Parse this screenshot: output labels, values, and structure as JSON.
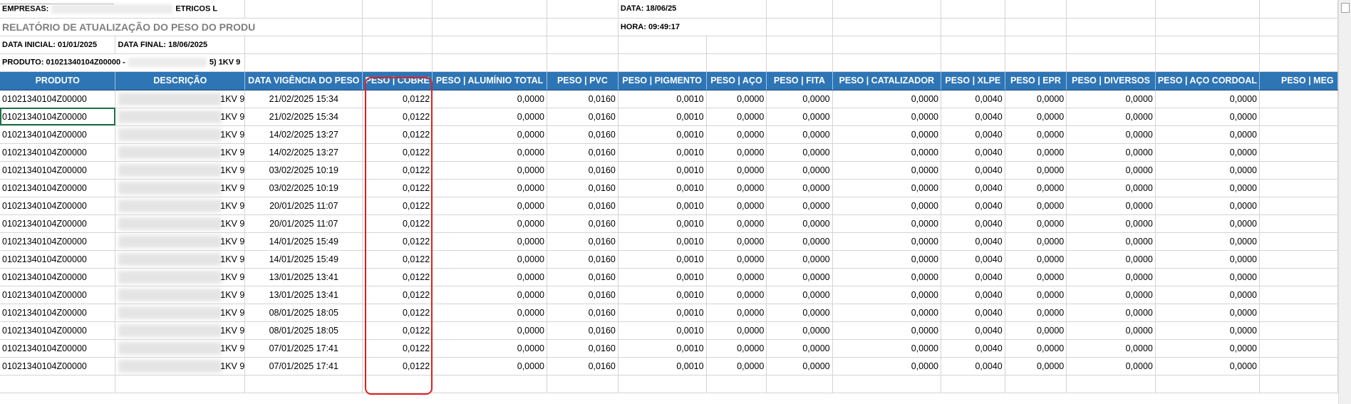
{
  "meta": {
    "empresas_label": "EMPRESAS:",
    "empresas_tail": "ETRICOS L",
    "title": "RELATÓRIO DE ATUALIZAÇÃO DO PESO DO PRODU",
    "data_inicial": "DATA INICIAL: 01/01/2025",
    "data_final": "DATA FINAL: 18/06/2025",
    "produto_prefix": "PRODUTO: 01021340104Z00000 -",
    "produto_tail": "5) 1KV 9",
    "data_label": "DATA: 18/06/25",
    "hora_label": "HORA: 09:49:17"
  },
  "columns": [
    "PRODUTO",
    "DESCRIÇÃO",
    "DATA VIGÊNCIA DO PESO",
    "PESO | COBRE",
    "PESO | ALUMÍNIO TOTAL",
    "PESO | PVC",
    "PESO | PIGMENTO",
    "PESO | AÇO",
    "PESO | FITA",
    "PESO | CATALIZADOR",
    "PESO | XLPE",
    "PESO | EPR",
    "PESO | DIVERSOS",
    "PESO | AÇO CORDOAL",
    "PESO | MEG"
  ],
  "rows": [
    {
      "produto": "01021340104Z00000",
      "desc_tail": "1KV 9",
      "data": "21/02/2025 15:34",
      "cobre": "0,0122",
      "aluminio": "0,0000",
      "pvc": "0,0160",
      "pigmento": "0,0010",
      "aco": "0,0000",
      "fita": "0,0000",
      "catalizador": "0,0000",
      "xlpe": "0,0040",
      "epr": "0,0000",
      "diversos": "0,0000",
      "aco_cordoal": "0,0000"
    },
    {
      "produto": "01021340104Z00000",
      "desc_tail": "1KV 9",
      "data": "21/02/2025 15:34",
      "cobre": "0,0122",
      "aluminio": "0,0000",
      "pvc": "0,0160",
      "pigmento": "0,0010",
      "aco": "0,0000",
      "fita": "0,0000",
      "catalizador": "0,0000",
      "xlpe": "0,0040",
      "epr": "0,0000",
      "diversos": "0,0000",
      "aco_cordoal": "0,0000"
    },
    {
      "produto": "01021340104Z00000",
      "desc_tail": "1KV 9",
      "data": "14/02/2025 13:27",
      "cobre": "0,0122",
      "aluminio": "0,0000",
      "pvc": "0,0160",
      "pigmento": "0,0010",
      "aco": "0,0000",
      "fita": "0,0000",
      "catalizador": "0,0000",
      "xlpe": "0,0040",
      "epr": "0,0000",
      "diversos": "0,0000",
      "aco_cordoal": "0,0000"
    },
    {
      "produto": "01021340104Z00000",
      "desc_tail": "1KV 9",
      "data": "14/02/2025 13:27",
      "cobre": "0,0122",
      "aluminio": "0,0000",
      "pvc": "0,0160",
      "pigmento": "0,0010",
      "aco": "0,0000",
      "fita": "0,0000",
      "catalizador": "0,0000",
      "xlpe": "0,0040",
      "epr": "0,0000",
      "diversos": "0,0000",
      "aco_cordoal": "0,0000"
    },
    {
      "produto": "01021340104Z00000",
      "desc_tail": "1KV 9",
      "data": "03/02/2025 10:19",
      "cobre": "0,0122",
      "aluminio": "0,0000",
      "pvc": "0,0160",
      "pigmento": "0,0010",
      "aco": "0,0000",
      "fita": "0,0000",
      "catalizador": "0,0000",
      "xlpe": "0,0040",
      "epr": "0,0000",
      "diversos": "0,0000",
      "aco_cordoal": "0,0000"
    },
    {
      "produto": "01021340104Z00000",
      "desc_tail": "1KV 9",
      "data": "03/02/2025 10:19",
      "cobre": "0,0122",
      "aluminio": "0,0000",
      "pvc": "0,0160",
      "pigmento": "0,0010",
      "aco": "0,0000",
      "fita": "0,0000",
      "catalizador": "0,0000",
      "xlpe": "0,0040",
      "epr": "0,0000",
      "diversos": "0,0000",
      "aco_cordoal": "0,0000"
    },
    {
      "produto": "01021340104Z00000",
      "desc_tail": "1KV 9",
      "data": "20/01/2025 11:07",
      "cobre": "0,0122",
      "aluminio": "0,0000",
      "pvc": "0,0160",
      "pigmento": "0,0010",
      "aco": "0,0000",
      "fita": "0,0000",
      "catalizador": "0,0000",
      "xlpe": "0,0040",
      "epr": "0,0000",
      "diversos": "0,0000",
      "aco_cordoal": "0,0000"
    },
    {
      "produto": "01021340104Z00000",
      "desc_tail": "1KV 9",
      "data": "20/01/2025 11:07",
      "cobre": "0,0122",
      "aluminio": "0,0000",
      "pvc": "0,0160",
      "pigmento": "0,0010",
      "aco": "0,0000",
      "fita": "0,0000",
      "catalizador": "0,0000",
      "xlpe": "0,0040",
      "epr": "0,0000",
      "diversos": "0,0000",
      "aco_cordoal": "0,0000"
    },
    {
      "produto": "01021340104Z00000",
      "desc_tail": "1KV 9",
      "data": "14/01/2025 15:49",
      "cobre": "0,0122",
      "aluminio": "0,0000",
      "pvc": "0,0160",
      "pigmento": "0,0010",
      "aco": "0,0000",
      "fita": "0,0000",
      "catalizador": "0,0000",
      "xlpe": "0,0040",
      "epr": "0,0000",
      "diversos": "0,0000",
      "aco_cordoal": "0,0000"
    },
    {
      "produto": "01021340104Z00000",
      "desc_tail": "1KV 9",
      "data": "14/01/2025 15:49",
      "cobre": "0,0122",
      "aluminio": "0,0000",
      "pvc": "0,0160",
      "pigmento": "0,0010",
      "aco": "0,0000",
      "fita": "0,0000",
      "catalizador": "0,0000",
      "xlpe": "0,0040",
      "epr": "0,0000",
      "diversos": "0,0000",
      "aco_cordoal": "0,0000"
    },
    {
      "produto": "01021340104Z00000",
      "desc_tail": "1KV 9",
      "data": "13/01/2025 13:41",
      "cobre": "0,0122",
      "aluminio": "0,0000",
      "pvc": "0,0160",
      "pigmento": "0,0010",
      "aco": "0,0000",
      "fita": "0,0000",
      "catalizador": "0,0000",
      "xlpe": "0,0040",
      "epr": "0,0000",
      "diversos": "0,0000",
      "aco_cordoal": "0,0000"
    },
    {
      "produto": "01021340104Z00000",
      "desc_tail": "1KV 9",
      "data": "13/01/2025 13:41",
      "cobre": "0,0122",
      "aluminio": "0,0000",
      "pvc": "0,0160",
      "pigmento": "0,0010",
      "aco": "0,0000",
      "fita": "0,0000",
      "catalizador": "0,0000",
      "xlpe": "0,0040",
      "epr": "0,0000",
      "diversos": "0,0000",
      "aco_cordoal": "0,0000"
    },
    {
      "produto": "01021340104Z00000",
      "desc_tail": "1KV 9",
      "data": "08/01/2025 18:05",
      "cobre": "0,0122",
      "aluminio": "0,0000",
      "pvc": "0,0160",
      "pigmento": "0,0010",
      "aco": "0,0000",
      "fita": "0,0000",
      "catalizador": "0,0000",
      "xlpe": "0,0040",
      "epr": "0,0000",
      "diversos": "0,0000",
      "aco_cordoal": "0,0000"
    },
    {
      "produto": "01021340104Z00000",
      "desc_tail": "1KV 9",
      "data": "08/01/2025 18:05",
      "cobre": "0,0122",
      "aluminio": "0,0000",
      "pvc": "0,0160",
      "pigmento": "0,0010",
      "aco": "0,0000",
      "fita": "0,0000",
      "catalizador": "0,0000",
      "xlpe": "0,0040",
      "epr": "0,0000",
      "diversos": "0,0000",
      "aco_cordoal": "0,0000"
    },
    {
      "produto": "01021340104Z00000",
      "desc_tail": "1KV 9",
      "data": "07/01/2025 17:41",
      "cobre": "0,0122",
      "aluminio": "0,0000",
      "pvc": "0,0160",
      "pigmento": "0,0010",
      "aco": "0,0000",
      "fita": "0,0000",
      "catalizador": "0,0000",
      "xlpe": "0,0040",
      "epr": "0,0000",
      "diversos": "0,0000",
      "aco_cordoal": "0,0000"
    },
    {
      "produto": "01021340104Z00000",
      "desc_tail": "1KV 9",
      "data": "07/01/2025 17:41",
      "cobre": "0,0122",
      "aluminio": "0,0000",
      "pvc": "0,0160",
      "pigmento": "0,0010",
      "aco": "0,0000",
      "fita": "0,0000",
      "catalizador": "0,0000",
      "xlpe": "0,0040",
      "epr": "0,0000",
      "diversos": "0,0000",
      "aco_cordoal": "0,0000"
    }
  ],
  "colors": {
    "header_bg": "#2e75b6",
    "highlight": "#e02020",
    "selection": "#1e7145"
  }
}
